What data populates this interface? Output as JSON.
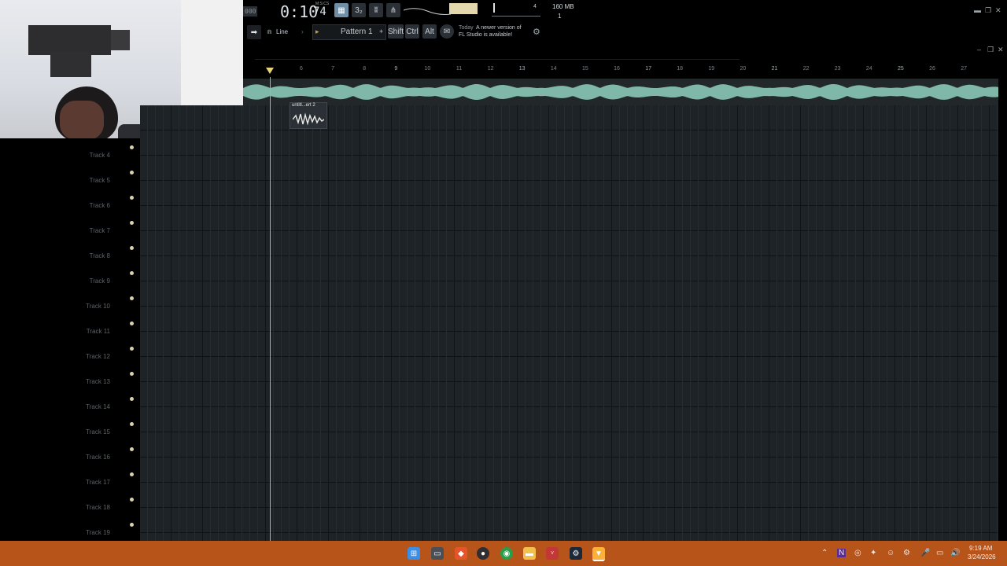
{
  "toolbar": {
    "time_prefix": "000",
    "time_main": "0:10",
    "time_frac": "74",
    "time_unit": "M:S:CS",
    "snap_label": "Line",
    "pattern_label": "Pattern 1",
    "mod_keys": [
      "Shift",
      "Ctrl",
      "Alt"
    ],
    "news_date": "Today",
    "news_text_line1": "A newer version of",
    "news_text_line2": "FL Studio is available!",
    "memory": "160 MB",
    "memory_sub": "1",
    "cpu_small": "4"
  },
  "audio_clip": {
    "label": "untitl...ert 2"
  },
  "ruler": {
    "bars": [
      "6",
      "7",
      "8",
      "9",
      "10",
      "11",
      "12",
      "13",
      "14",
      "15",
      "16",
      "17",
      "18",
      "19",
      "20",
      "21",
      "22",
      "23",
      "24",
      "25",
      "26",
      "27"
    ],
    "major": [
      "9",
      "13",
      "17",
      "21",
      "25"
    ]
  },
  "tracks": [
    {
      "name": "Track 4"
    },
    {
      "name": "Track 5"
    },
    {
      "name": "Track 6"
    },
    {
      "name": "Track 7"
    },
    {
      "name": "Track 8"
    },
    {
      "name": "Track 9"
    },
    {
      "name": "Track 10"
    },
    {
      "name": "Track 11"
    },
    {
      "name": "Track 12"
    },
    {
      "name": "Track 13"
    },
    {
      "name": "Track 14"
    },
    {
      "name": "Track 15"
    },
    {
      "name": "Track 16"
    },
    {
      "name": "Track 17"
    },
    {
      "name": "Track 18"
    },
    {
      "name": "Track 19"
    }
  ],
  "taskbar": {
    "clock_time": "9:19 AM",
    "clock_date": "3/24/2026",
    "apps": [
      "windows-start",
      "file-explorer",
      "brave",
      "obs",
      "chrome",
      "folder",
      "voicemeeter",
      "steam",
      "fl-studio"
    ]
  },
  "colors": {
    "accent_playhead": "#c9b24a",
    "waveform": "#7fb7a8",
    "taskbar": "#b6541a",
    "grid_bg": "#1e2327"
  }
}
